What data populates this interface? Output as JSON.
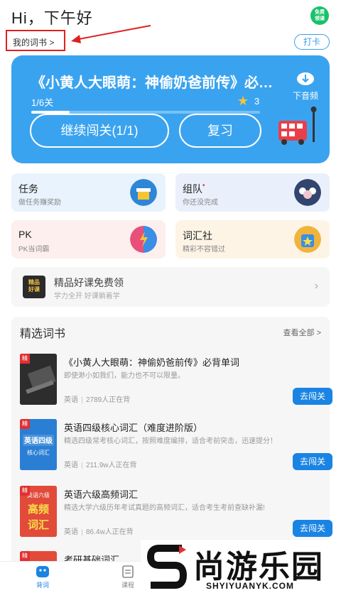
{
  "header": {
    "greeting": "Hi，下午好",
    "free_badge": "免费\n领课",
    "my_book_label": "我的词书 >",
    "checkin_label": "打卡"
  },
  "hero": {
    "title": "《小黄人大眼萌：神偷奶爸前传》必…",
    "progress_label": "1/6关",
    "progress_fraction": 0.167,
    "stars_count": "3",
    "continue_label": "继续闯关(1/1)",
    "review_label": "复习",
    "download_label": "下音频"
  },
  "tiles": [
    {
      "title": "任务",
      "subtitle": "做任务赚奖励",
      "dot": false,
      "bg": "#e8f3fd",
      "icon_color": "#2e86d6"
    },
    {
      "title": "组队",
      "subtitle": "你还没完成",
      "dot": true,
      "bg": "#eaf0fb",
      "icon_color": "#31456e"
    },
    {
      "title": "PK",
      "subtitle": "PK当词霸",
      "dot": false,
      "bg": "#fcefee",
      "icon_color": "#e8507a"
    },
    {
      "title": "词汇社",
      "subtitle": "精彩不容错过",
      "dot": false,
      "bg": "#fdf4e6",
      "icon_color": "#f0b43c"
    }
  ],
  "promo": {
    "icon_text": "精品好课",
    "title": "精品好课免费领",
    "subtitle": "学力全开 好课躺着学"
  },
  "section": {
    "title": "精选词书",
    "view_all": "查看全部 >",
    "tag": "精",
    "go_label": "去闯关",
    "books": [
      {
        "title": "《小黄人大眼萌：神偷奶爸前传》必背单词",
        "desc": "即使渺小如我们，能力也不可以限量。",
        "lang": "英语",
        "count": "2789人正在背",
        "cover": "#2a2a2a",
        "cover_text": ""
      },
      {
        "title": "英语四级核心词汇（难度进阶版）",
        "desc": "精选四级常考核心词汇，按照难度编排，适合考前突击，迅速提分！",
        "lang": "英语",
        "count": "211.9w人正在背",
        "cover": "#2a7fd4",
        "cover_text": "英语四级\n核心词汇"
      },
      {
        "title": "英语六级高频词汇",
        "desc": "精选大学六级历年考试真题的高频词汇，适合考生考前查缺补漏!",
        "lang": "英语",
        "count": "86.4w人正在背",
        "cover": "#e24a3a",
        "cover_text": "英语六级\n高频\n词汇"
      },
      {
        "title": "考研基础词汇",
        "desc": "",
        "lang": "",
        "count": "",
        "cover": "#e24a3a",
        "cover_text": ""
      }
    ]
  },
  "tabbar": {
    "tab_words": "背词",
    "tab_courses": "课程"
  },
  "watermark": {
    "text": "尚游乐园",
    "url": "SHYIYUANYK.COM"
  }
}
